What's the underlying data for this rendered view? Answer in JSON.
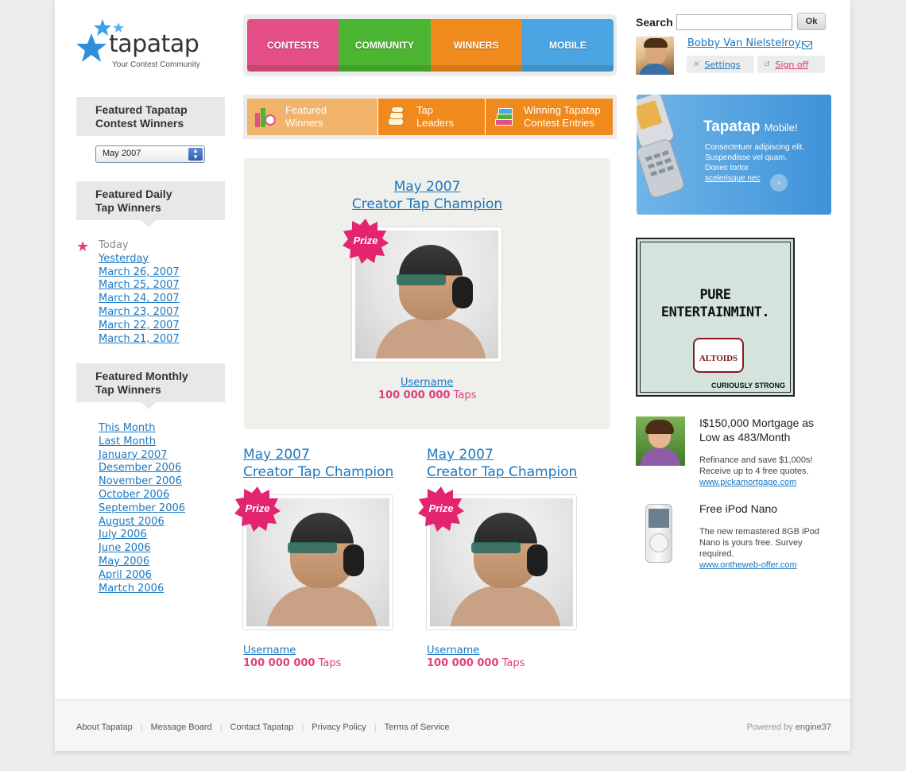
{
  "brand": {
    "name": "tapatap",
    "tagline": "Your Contest Community"
  },
  "nav": {
    "tabs": [
      {
        "label": "CONTESTS",
        "color": "#e34f86"
      },
      {
        "label": "COMMUNITY",
        "color": "#4cb531"
      },
      {
        "label": "WINNERS",
        "color": "#f08a1c"
      },
      {
        "label": "MOBILE",
        "color": "#4aa5e2"
      }
    ]
  },
  "search": {
    "label": "Search",
    "value": "",
    "button": "Ok"
  },
  "user": {
    "name": "Bobby Van Nielstelroy",
    "settings": "Settings",
    "signoff": "Sign off"
  },
  "sidebar": {
    "contest_winners_heading_1": "Featured Tapatap",
    "contest_winners_heading_2": "Contest Winners",
    "month_select": "May 2007",
    "daily_heading_1": "Featured Daily",
    "daily_heading_2": "Tap Winners",
    "daily_today": "Today",
    "daily_links": [
      "Yesterday",
      "March 26, 2007",
      "March 25, 2007",
      "March 24, 2007",
      "March 23, 2007",
      "March 22, 2007",
      "March 21, 2007"
    ],
    "monthly_heading_1": "Featured Monthly",
    "monthly_heading_2": "Tap Winners",
    "monthly_links": [
      "This Month",
      "Last Month",
      "January 2007",
      "Desember 2006",
      "November 2006",
      "October 2006",
      "September 2006",
      "August 2006",
      "July 2006",
      "June 2006",
      "May 2006",
      "April 2006",
      "Martch 2006"
    ]
  },
  "subnav": {
    "tabs": [
      {
        "line1": "Featured",
        "line2": "Winners"
      },
      {
        "line1": "Tap",
        "line2": "Leaders"
      },
      {
        "line1": "Winning Tapatap",
        "line2": "Contest Entries"
      }
    ]
  },
  "winners": [
    {
      "month": "May 2007",
      "title": "Creator Tap Champion",
      "badge": "Prize",
      "username": "Username",
      "taps": "100 000 000",
      "taps_unit": "Taps"
    },
    {
      "month": "May 2007",
      "title": "Creator Tap Champion",
      "badge": "Prize",
      "username": "Username",
      "taps": "100 000 000",
      "taps_unit": "Taps"
    },
    {
      "month": "May 2007",
      "title": "Creator Tap Champion",
      "badge": "Prize",
      "username": "Username",
      "taps": "100 000 000",
      "taps_unit": "Taps"
    }
  ],
  "mobile_banner": {
    "title": "Tapatap",
    "title_suffix": "Mobile!",
    "text_1": "Consectetuer adipiscing elit.",
    "text_2": "Suspendisse vel quam.",
    "text_3": "Donec tortor",
    "link": "scelerisque nec"
  },
  "ad": {
    "headline_1": "PURE",
    "headline_2": "ENTERTAINMINT.",
    "product": "ALTOIDS",
    "footer": "CURIOUSLY STRONG"
  },
  "promos": [
    {
      "title": "I$150,000 Mortgage as Low as 483/Month",
      "desc": "Refinance and save $1,000s! Receive up to 4 free quotes.",
      "link": "www.pickamortgage.com"
    },
    {
      "title": "Free iPod Nano",
      "desc": "The new remastered 8GB iPod Nano is yours free. Survey required.",
      "link": "www.ontheweb-offer.com"
    }
  ],
  "footer": {
    "links": [
      "About Tapatap",
      "Message Board",
      "Contact Tapatap",
      "Privacy Policy",
      "Terms of Service"
    ],
    "powered_prefix": "Powered by",
    "powered_brand": "engine37"
  }
}
